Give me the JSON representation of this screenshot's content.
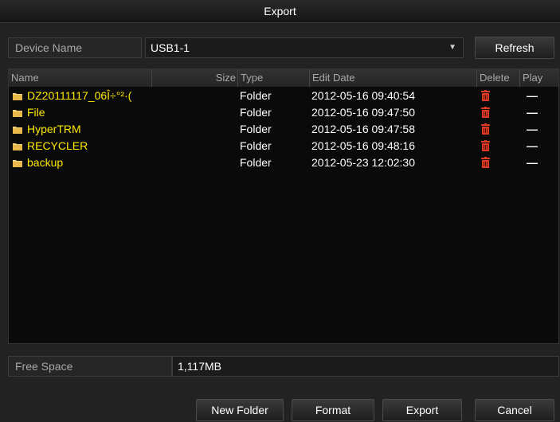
{
  "window": {
    "title": "Export"
  },
  "device": {
    "label": "Device Name",
    "value": "USB1-1",
    "refresh_label": "Refresh"
  },
  "table": {
    "columns": {
      "name": "Name",
      "size": "Size",
      "type": "Type",
      "edit_date": "Edit Date",
      "delete": "Delete",
      "play": "Play"
    },
    "rows": [
      {
        "name": "DZ20111117_06Î÷°²·(",
        "type": "Folder",
        "edit_date": "2012-05-16 09:40:54",
        "play": "—"
      },
      {
        "name": "File",
        "type": "Folder",
        "edit_date": "2012-05-16 09:47:50",
        "play": "—"
      },
      {
        "name": "HyperTRM",
        "type": "Folder",
        "edit_date": "2012-05-16 09:47:58",
        "play": "—"
      },
      {
        "name": "RECYCLER",
        "type": "Folder",
        "edit_date": "2012-05-16 09:48:16",
        "play": "—"
      },
      {
        "name": "backup",
        "type": "Folder",
        "edit_date": "2012-05-23 12:02:30",
        "play": "—"
      }
    ]
  },
  "free_space": {
    "label": "Free Space",
    "value": "1,117MB"
  },
  "footer": {
    "new_folder_label": "New Folder",
    "format_label": "Format",
    "export_label": "Export",
    "cancel_label": "Cancel"
  },
  "colors": {
    "folder_name": "#ffe800",
    "trash": "#e03a24",
    "folder_icon": "#f2d27a"
  },
  "icons": {
    "folder": "folder-icon",
    "delete": "trash-icon",
    "play": "dash-icon",
    "dropdown": "chevron-down-icon"
  }
}
